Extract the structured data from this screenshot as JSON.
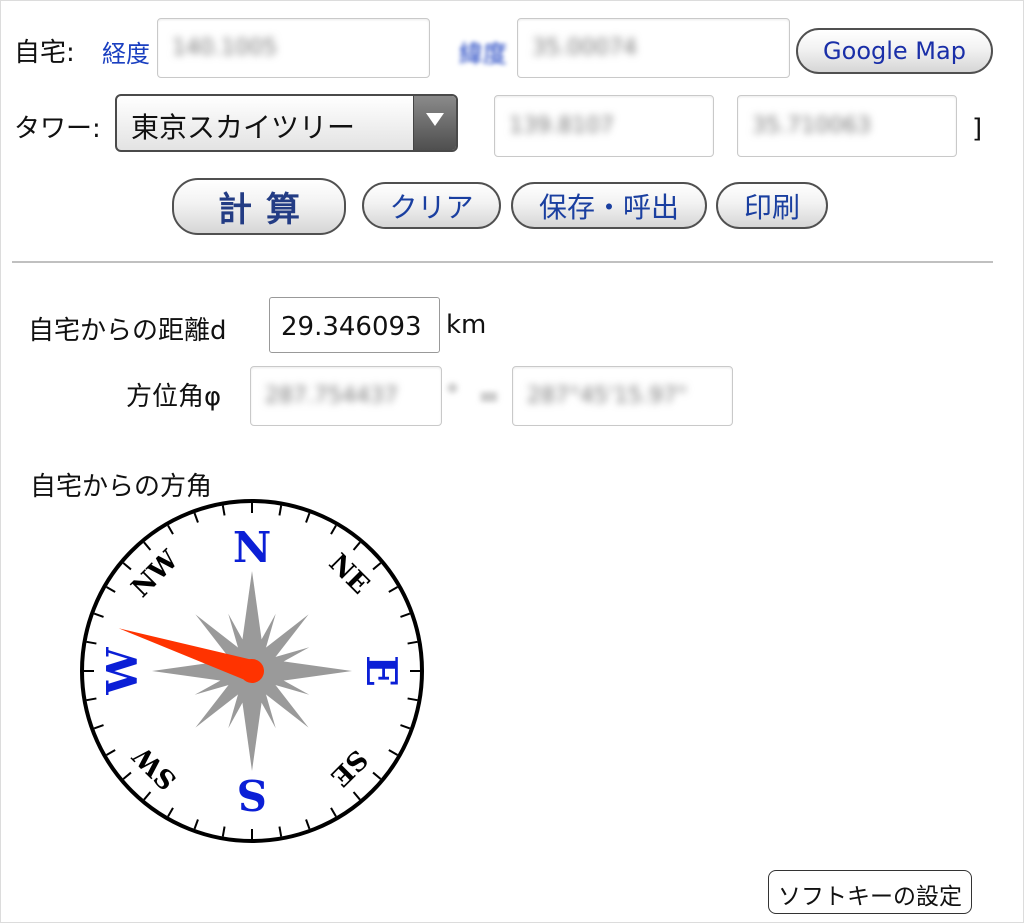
{
  "home": {
    "label": "自宅:",
    "longitude_label": "経度",
    "latitude_label": "緯度",
    "longitude_value": "140.1005",
    "latitude_value": "35.00074",
    "google_map_button": "Google Map"
  },
  "tower": {
    "label": "タワー:",
    "selected": "東京スカイツリー",
    "longitude_value": "139.8107",
    "latitude_value": "35.710063",
    "close_bracket": "]"
  },
  "actions": {
    "calculate": "計算",
    "clear": "クリア",
    "save_load": "保存・呼出",
    "print": "印刷"
  },
  "results": {
    "distance_label": "自宅からの距離d",
    "distance_value": "29.346093",
    "distance_unit": "km",
    "azimuth_label": "方位角φ",
    "azimuth_deg": "287.754437",
    "degree_symbol": "°",
    "equals": "=",
    "azimuth_dms": "287°45'15.97\""
  },
  "compass": {
    "title": "自宅からの方角",
    "north": "N",
    "east": "E",
    "south": "S",
    "west": "W",
    "northeast": "NE",
    "southeast": "SE",
    "southwest": "SW",
    "northwest": "NW",
    "needle_bearing_deg": 287.754437,
    "needle_color": "#ff3300",
    "cardinal_color": "#0b1fd6",
    "rose_color": "#9a9a9a"
  },
  "footer": {
    "softkey_settings": "ソフトキーの設定"
  }
}
